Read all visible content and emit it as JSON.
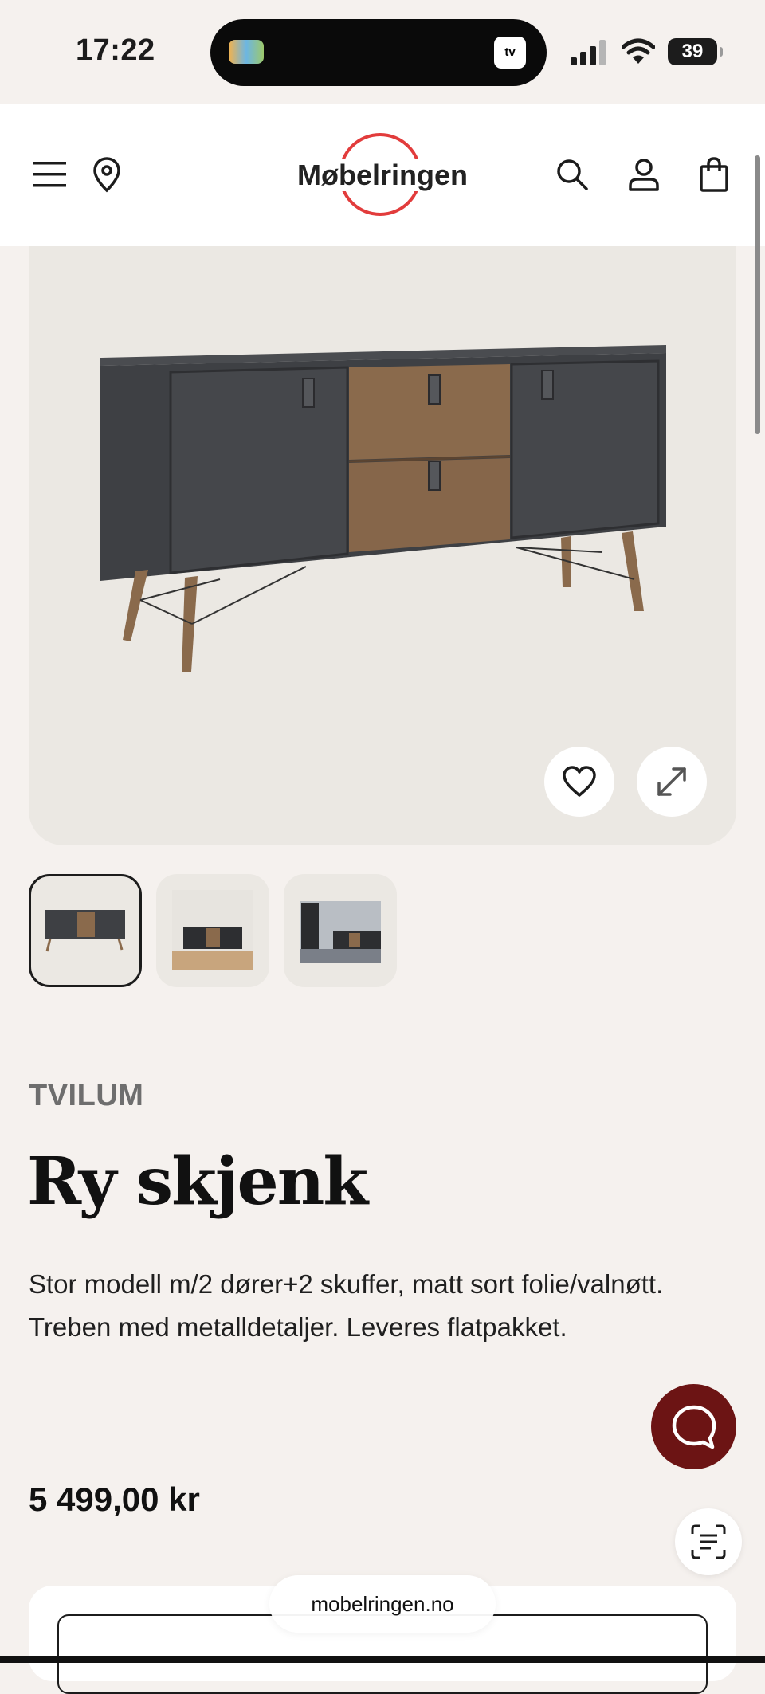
{
  "status_bar": {
    "time": "17:22",
    "battery": "39",
    "tv_label": "tv"
  },
  "header": {
    "logo_text": "Møbelringen"
  },
  "product": {
    "brand": "TVILUM",
    "title": "Ry skjenk",
    "description": "Stor modell m/2 dører+2 skuffer, matt sort folie/valnøtt. Treben med metalldetaljer. Leveres flatpakket.",
    "price": "5 499,00 kr"
  },
  "gallery": {
    "selected_index": 0,
    "thumbnail_count": 3
  },
  "browser": {
    "url": "mobelringen.no"
  },
  "colors": {
    "accent_red": "#e23c3c",
    "chat_bg": "#6c1414",
    "page_bg": "#f5f1ee"
  }
}
